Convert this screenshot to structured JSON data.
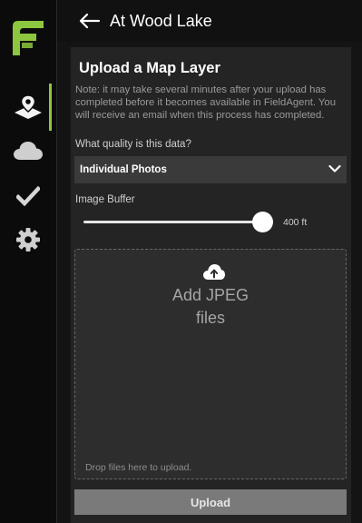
{
  "header": {
    "title": "At Wood Lake"
  },
  "sidebar": {
    "items": [
      {
        "icon": "map-pin-layers-icon",
        "active": true
      },
      {
        "icon": "cloud-icon",
        "active": false
      },
      {
        "icon": "check-icon",
        "active": false
      },
      {
        "icon": "gear-icon",
        "active": false
      }
    ]
  },
  "panel": {
    "title": "Upload a Map Layer",
    "note": "Note: it may take several minutes after your upload has completed before it becomes available in FieldAgent. You will receive an email when this process has completed.",
    "quality_label": "What quality is this data?",
    "quality_value": "Individual Photos",
    "buffer_label": "Image Buffer",
    "buffer_value": "400 ft",
    "drop_title_line1": "Add JPEG",
    "drop_title_line2": "files",
    "drop_hint": "Drop files here to upload.",
    "upload_label": "Upload"
  },
  "colors": {
    "accent": "#8dc63f",
    "background": "#141414",
    "panel": "#242424"
  }
}
